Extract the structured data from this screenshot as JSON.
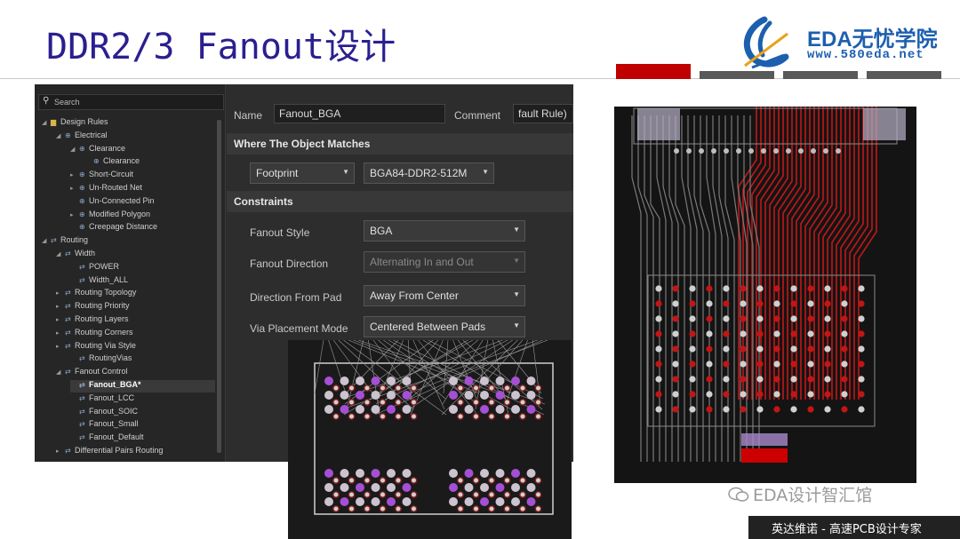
{
  "slide": {
    "title": "DDR2/3 Fanout设计",
    "logo_brand": "EDA无忧学院",
    "logo_url": "www.580eda.net",
    "watermark": "EDA设计智汇馆",
    "footer": "英达维诺 - 高速PCB设计专家",
    "accent_colors": [
      "#c00000",
      "#595959"
    ]
  },
  "dialog": {
    "search_placeholder": "Search",
    "tree": [
      {
        "label": "Design Rules",
        "level": 0,
        "arrow": "◢",
        "icon": "folder-icon"
      },
      {
        "label": "Electrical",
        "level": 1,
        "arrow": "◢",
        "icon": "rule-icon"
      },
      {
        "label": "Clearance",
        "level": 2,
        "arrow": "◢",
        "icon": "rule-icon"
      },
      {
        "label": "Clearance",
        "level": 3,
        "arrow": "",
        "icon": "rule-icon"
      },
      {
        "label": "Short-Circuit",
        "level": 2,
        "arrow": "▸",
        "icon": "rule-icon"
      },
      {
        "label": "Un-Routed Net",
        "level": 2,
        "arrow": "▸",
        "icon": "rule-icon"
      },
      {
        "label": "Un-Connected Pin",
        "level": 2,
        "arrow": "",
        "icon": "rule-icon"
      },
      {
        "label": "Modified Polygon",
        "level": 2,
        "arrow": "▸",
        "icon": "rule-icon"
      },
      {
        "label": "Creepage Distance",
        "level": 2,
        "arrow": "",
        "icon": "rule-icon"
      },
      {
        "label": "Routing",
        "level": 0,
        "arrow": "◢",
        "icon": "route-icon"
      },
      {
        "label": "Width",
        "level": 1,
        "arrow": "◢",
        "icon": "route-icon"
      },
      {
        "label": "POWER",
        "level": 2,
        "arrow": "",
        "icon": "route-icon"
      },
      {
        "label": "Width_ALL",
        "level": 2,
        "arrow": "",
        "icon": "route-icon"
      },
      {
        "label": "Routing Topology",
        "level": 1,
        "arrow": "▸",
        "icon": "route-icon"
      },
      {
        "label": "Routing Priority",
        "level": 1,
        "arrow": "▸",
        "icon": "route-icon"
      },
      {
        "label": "Routing Layers",
        "level": 1,
        "arrow": "▸",
        "icon": "route-icon"
      },
      {
        "label": "Routing Corners",
        "level": 1,
        "arrow": "▸",
        "icon": "route-icon"
      },
      {
        "label": "Routing Via Style",
        "level": 1,
        "arrow": "▸",
        "icon": "route-icon"
      },
      {
        "label": "RoutingVias",
        "level": 2,
        "arrow": "",
        "icon": "route-icon"
      },
      {
        "label": "Fanout Control",
        "level": 1,
        "arrow": "◢",
        "icon": "route-icon"
      },
      {
        "label": "Fanout_BGA*",
        "level": 2,
        "arrow": "",
        "icon": "route-icon",
        "selected": true
      },
      {
        "label": "Fanout_LCC",
        "level": 2,
        "arrow": "",
        "icon": "route-icon"
      },
      {
        "label": "Fanout_SOIC",
        "level": 2,
        "arrow": "",
        "icon": "route-icon"
      },
      {
        "label": "Fanout_Small",
        "level": 2,
        "arrow": "",
        "icon": "route-icon"
      },
      {
        "label": "Fanout_Default",
        "level": 2,
        "arrow": "",
        "icon": "route-icon"
      },
      {
        "label": "Differential Pairs Routing",
        "level": 1,
        "arrow": "▸",
        "icon": "route-icon"
      }
    ],
    "name_label": "Name",
    "name_value": "Fanout_BGA",
    "comment_label": "Comment",
    "comment_value": "fault Rule)",
    "where_header": "Where The Object Matches",
    "match_type": "Footprint",
    "match_value": "BGA84-DDR2-512M",
    "constraints_header": "Constraints",
    "fields": [
      {
        "label": "Fanout Style",
        "value": "BGA",
        "disabled": false
      },
      {
        "label": "Fanout Direction",
        "value": "Alternating In and Out",
        "disabled": true
      },
      {
        "label": "Direction From Pad",
        "value": "Away From Center",
        "disabled": false
      },
      {
        "label": "Via Placement Mode",
        "value": "Centered Between Pads",
        "disabled": false
      }
    ]
  }
}
